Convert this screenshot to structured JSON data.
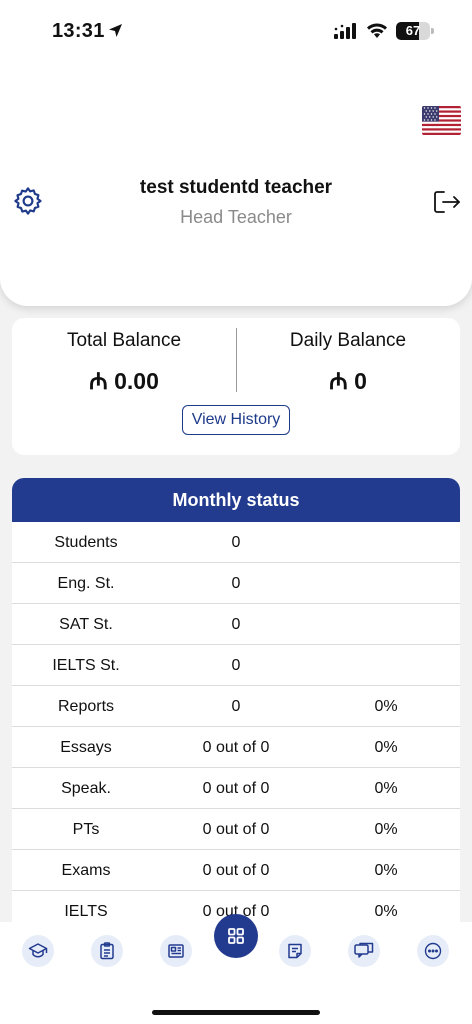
{
  "status_bar": {
    "time": "13:31",
    "battery": "67"
  },
  "header": {
    "user_name": "test studentd teacher",
    "user_role": "Head Teacher",
    "settings_icon": "gear-icon",
    "logout_icon": "logout-icon",
    "language_flag": "us-flag-icon"
  },
  "balance": {
    "total_label": "Total Balance",
    "total_value": "₼ 0.00",
    "daily_label": "Daily Balance",
    "daily_value": "₼ 0",
    "view_history_label": "View History"
  },
  "monthly_status": {
    "title": "Monthly status",
    "rows": [
      {
        "label": "Students",
        "value": "0",
        "percent": ""
      },
      {
        "label": "Eng. St.",
        "value": "0",
        "percent": ""
      },
      {
        "label": "SAT St.",
        "value": "0",
        "percent": ""
      },
      {
        "label": "IELTS St.",
        "value": "0",
        "percent": ""
      },
      {
        "label": "Reports",
        "value": "0",
        "percent": "0%"
      },
      {
        "label": "Essays",
        "value": "0 out of 0",
        "percent": "0%"
      },
      {
        "label": "Speak.",
        "value": "0 out of 0",
        "percent": "0%"
      },
      {
        "label": "PTs",
        "value": "0 out of 0",
        "percent": "0%"
      },
      {
        "label": "Exams",
        "value": "0 out of 0",
        "percent": "0%"
      },
      {
        "label": "IELTS",
        "value": "0 out of 0",
        "percent": "0%"
      }
    ]
  },
  "bottom_nav": {
    "items": [
      "graduation-cap-icon",
      "clipboard-icon",
      "newspaper-icon",
      "grid-icon",
      "notes-icon",
      "chat-icon",
      "more-icon"
    ],
    "accent": "#233b8f"
  }
}
